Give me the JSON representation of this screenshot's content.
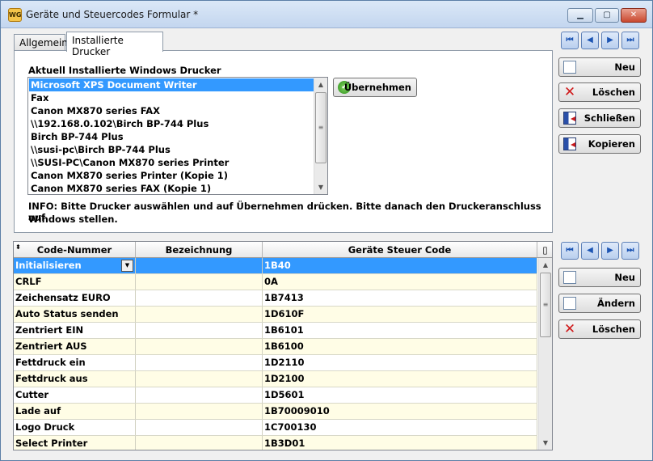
{
  "window": {
    "title": "Geräte und Steuercodes Formular *",
    "app_icon_text": "WG",
    "minimize": "▁",
    "maximize": "▢",
    "close": "✕"
  },
  "tabs": [
    {
      "label": "Allgemein",
      "selected": false
    },
    {
      "label": "Installierte Drucker",
      "selected": true
    }
  ],
  "printers": {
    "heading": "Aktuell Installierte Windows Drucker",
    "items": [
      "Microsoft XPS Document Writer",
      "Fax",
      "Canon MX870 series FAX",
      "\\\\192.168.0.102\\Birch BP-744 Plus",
      "Birch BP-744 Plus",
      "\\\\susi-pc\\Birch BP-744 Plus",
      "\\\\SUSI-PC\\Canon MX870 series Printer",
      "Canon MX870 series Printer (Kopie 1)",
      "Canon MX870 series FAX (Kopie 1)"
    ],
    "selected_index": 0,
    "apply_button": "Übernehmen",
    "info_line1": "INFO: Bitte Drucker auswählen und auf Übernehmen drücken. Bitte danach den Druckeranschluss auf",
    "info_line2": "Windows stellen."
  },
  "right_panel_top": {
    "nav": [
      "first",
      "previous",
      "next",
      "last"
    ],
    "buttons": [
      {
        "label": "Neu",
        "icon": "new-document-icon"
      },
      {
        "label": "Löschen",
        "icon": "delete-x-icon"
      },
      {
        "label": "Schließen",
        "icon": "exit-door-icon"
      },
      {
        "label": "Kopieren",
        "icon": "exit-door-icon"
      }
    ]
  },
  "right_panel_bottom": {
    "nav": [
      "first",
      "previous",
      "next",
      "last"
    ],
    "buttons": [
      {
        "label": "Neu",
        "icon": "new-document-icon"
      },
      {
        "label": "Ändern",
        "icon": "edit-icon"
      },
      {
        "label": "Löschen",
        "icon": "delete-x-icon"
      }
    ]
  },
  "grid": {
    "columns": [
      "Code-Nummer",
      "Bezeichnung",
      "Geräte Steuer Code"
    ],
    "rows": [
      {
        "code": "Initialisieren",
        "bez": "",
        "steuer": "1B40",
        "selected": true
      },
      {
        "code": "CRLF",
        "bez": "",
        "steuer": "0A"
      },
      {
        "code": "Zeichensatz EURO",
        "bez": "",
        "steuer": "1B7413"
      },
      {
        "code": "Auto Status senden",
        "bez": "",
        "steuer": "1D610F"
      },
      {
        "code": "Zentriert EIN",
        "bez": "",
        "steuer": "1B6101"
      },
      {
        "code": "Zentriert AUS",
        "bez": "",
        "steuer": "1B6100"
      },
      {
        "code": "Fettdruck ein",
        "bez": "",
        "steuer": "1D2110"
      },
      {
        "code": "Fettdruck aus",
        "bez": "",
        "steuer": "1D2100"
      },
      {
        "code": "Cutter",
        "bez": "",
        "steuer": "1D5601"
      },
      {
        "code": "Lade auf",
        "bez": "",
        "steuer": "1B70009010"
      },
      {
        "code": "Logo Druck",
        "bez": "",
        "steuer": "1C700130"
      },
      {
        "code": "Select Printer",
        "bez": "",
        "steuer": "1B3D01"
      }
    ]
  },
  "colors": {
    "selection": "#3399ff",
    "row_alt": "#fffde6",
    "window_bg": "#f0f0f0"
  }
}
